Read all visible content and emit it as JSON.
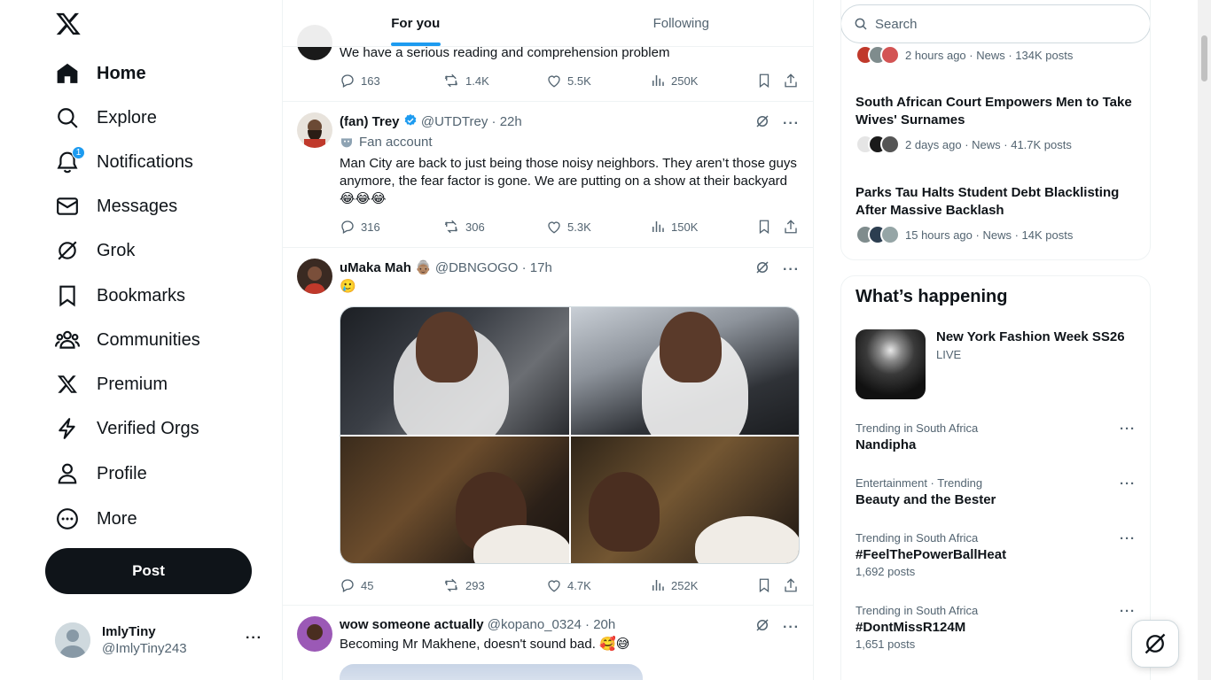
{
  "sidebar": {
    "items": [
      {
        "label": "Home",
        "icon": "home-icon"
      },
      {
        "label": "Explore",
        "icon": "search-icon"
      },
      {
        "label": "Notifications",
        "icon": "bell-icon",
        "badge": "1"
      },
      {
        "label": "Messages",
        "icon": "envelope-icon"
      },
      {
        "label": "Grok",
        "icon": "grok-icon"
      },
      {
        "label": "Bookmarks",
        "icon": "bookmark-icon"
      },
      {
        "label": "Communities",
        "icon": "communities-icon"
      },
      {
        "label": "Premium",
        "icon": "x-logo-icon"
      },
      {
        "label": "Verified Orgs",
        "icon": "lightning-icon"
      },
      {
        "label": "Profile",
        "icon": "person-icon"
      },
      {
        "label": "More",
        "icon": "more-circle-icon"
      }
    ],
    "post_label": "Post",
    "account": {
      "name": "ImlyTiny",
      "handle": "@ImlyTiny243"
    }
  },
  "tabs": [
    {
      "label": "For you",
      "active": true
    },
    {
      "label": "Following",
      "active": false
    }
  ],
  "tweets": [
    {
      "text": "We have a serious reading and comprehension problem",
      "replies": "163",
      "retweets": "1.4K",
      "likes": "5.5K",
      "views": "250K"
    },
    {
      "name": "(fan) Trey",
      "handle": "@UTDTrey",
      "time": "· 22h",
      "verified": true,
      "fan_label": "Fan account",
      "text": "Man City are back to just being those noisy neighbors. They aren’t those guys anymore, the fear factor is gone. We are putting on a show at their backyard😂😂😂",
      "replies": "316",
      "retweets": "306",
      "likes": "5.3K",
      "views": "150K"
    },
    {
      "name": "uMaka Mah 👵🏽",
      "handle": "@DBNGOGO",
      "time": "· 17h",
      "text": "🥲",
      "replies": "45",
      "retweets": "293",
      "likes": "4.7K",
      "views": "252K"
    },
    {
      "name": "wow someone actually",
      "handle": "@kopano_0324",
      "time": "· 20h",
      "text": "Becoming Mr Makhene, doesn't sound bad. 🥰😅"
    }
  ],
  "search": {
    "placeholder": "Search"
  },
  "news": [
    {
      "title": "",
      "meta": "2 hours ago · News · 134K posts"
    },
    {
      "title": "South African Court Empowers Men to Take Wives' Surnames",
      "meta": "2 days ago · News · 41.7K posts"
    },
    {
      "title": "Parks Tau Halts Student Debt Blacklisting After Massive Backlash",
      "meta": "15 hours ago · News · 14K posts"
    }
  ],
  "whats_happening": {
    "title": "What’s happening",
    "featured": {
      "title": "New York Fashion Week SS26",
      "status": "LIVE"
    },
    "trends": [
      {
        "context": "Trending in South Africa",
        "topic": "Nandipha",
        "posts": ""
      },
      {
        "context": "Entertainment · Trending",
        "topic": "Beauty and the Bester",
        "posts": ""
      },
      {
        "context": "Trending in South Africa",
        "topic": "#FeelThePowerBallHeat",
        "posts": "1,692 posts"
      },
      {
        "context": "Trending in South Africa",
        "topic": "#DontMissR124M",
        "posts": "1,651 posts"
      }
    ]
  },
  "colors": {
    "accent": "#1d9bf0",
    "text": "#0f1419",
    "muted": "#536471",
    "border": "#eff3f4"
  }
}
